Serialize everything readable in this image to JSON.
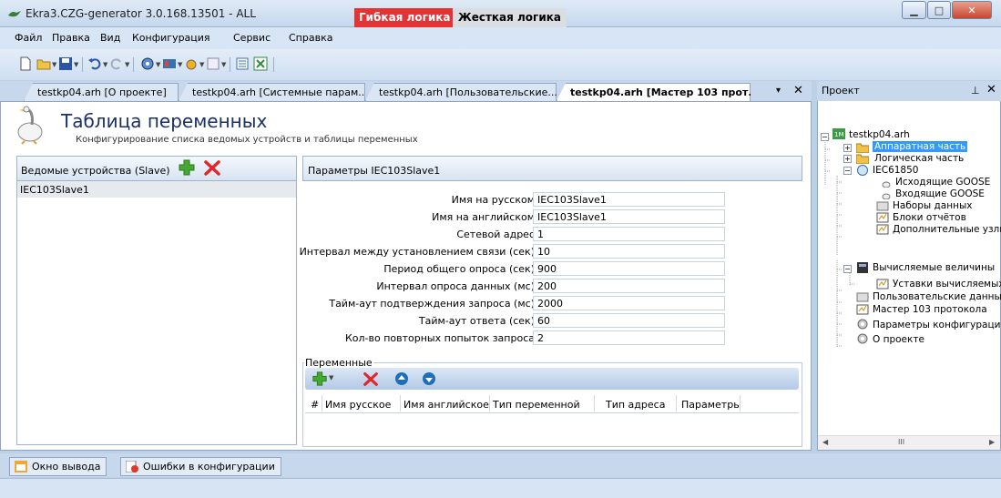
{
  "window": {
    "title": "Ekra3.CZG-generator 3.0.168.13501 - ALL",
    "minimize_glyph": "▁",
    "maximize_glyph": "□",
    "close_glyph": "✕"
  },
  "menu": {
    "items": [
      "Файл",
      "Правка",
      "Вид",
      "Конфигурация",
      "Сервис",
      "Справка"
    ]
  },
  "toolbar": {
    "flex_logic": "Гибкая логика",
    "hard_logic": "Жесткая логика",
    "flex_logic_color": "#e53232"
  },
  "tabs": [
    "testkp04.arh [О проекте]",
    "testkp04.arh [Системные парам...",
    "testkp04.arh [Пользовательские...",
    "testkp04.arh [Мастер 103 прот..."
  ],
  "tabbar": {
    "menu_glyph": "▾",
    "close_glyph": "✕"
  },
  "header": {
    "title": "Таблица переменных",
    "subtitle": "Конфигурирование списка ведомых устройств и таблицы переменных"
  },
  "slaves": {
    "header": "Ведомые устройства (Slave)",
    "items": [
      "IEC103Slave1"
    ]
  },
  "params": {
    "header": "Параметры IEC103Slave1",
    "fields": [
      {
        "label": "Имя на русском",
        "value": "IEC103Slave1"
      },
      {
        "label": "Имя на английском",
        "value": "IEC103Slave1"
      },
      {
        "label": "Сетевой адрес",
        "value": "1"
      },
      {
        "label": "Интервал между установлением связи (сек)",
        "value": "10"
      },
      {
        "label": "Период общего опроса (сек)",
        "value": "900"
      },
      {
        "label": "Интервал опроса данных (мс)",
        "value": "200"
      },
      {
        "label": "Тайм-аут подтверждения запроса (мс)",
        "value": "2000"
      },
      {
        "label": "Тайм-аут ответа (сек)",
        "value": "60"
      },
      {
        "label": "Кол-во повторных попыток запроса",
        "value": "2"
      }
    ]
  },
  "variables": {
    "legend": "Переменные",
    "columns": [
      "#",
      "Имя русское",
      "Имя английское",
      "Тип переменной",
      "Тип адреса",
      "Параметры"
    ]
  },
  "project": {
    "title": "Проект",
    "pin_glyph": "⊥",
    "close_glyph": "✕",
    "scroll_dots": "III",
    "tree": [
      "testkp04.arh",
      "Аппаратная часть",
      "Логическая часть",
      "IEC61850",
      "Исходящие GOOSE",
      "Входящие GOOSE",
      "Наборы данных",
      "Блоки отчётов",
      "Дополнительные узлы",
      "Вычисляемые величины",
      "Уставки вычисляемых",
      "Пользовательские данные",
      "Мастер 103 протокола",
      "Параметры конфигурации",
      "О проекте"
    ]
  },
  "bottom_tabs": [
    "Окно вывода",
    "Ошибки в конфигурации"
  ]
}
